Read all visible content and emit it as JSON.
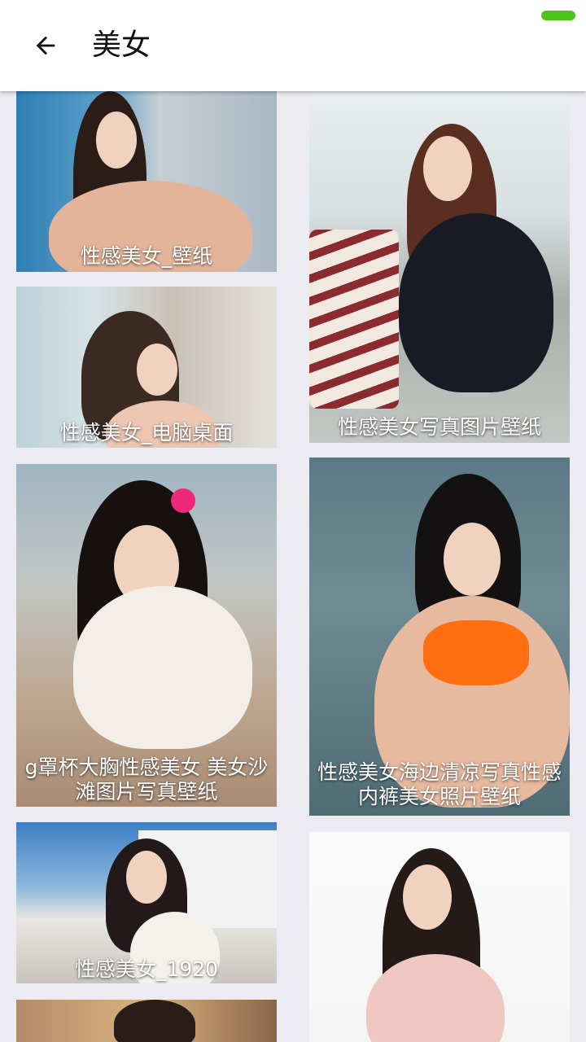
{
  "app_bar": {
    "title": "美女",
    "back_icon": "arrow-left-icon"
  },
  "colors": {
    "status_indicator": "#4BC41A",
    "background": "#ECEBF1"
  },
  "gallery": {
    "left_column": [
      {
        "caption": "性感美女_壁纸"
      },
      {
        "caption": "性感美女_电脑桌面"
      },
      {
        "caption": "g罩杯大胸性感美女 美女沙滩图片写真壁纸"
      },
      {
        "caption": "性感美女_1920"
      }
    ],
    "right_column": [
      {
        "caption": "性感美女写真图片壁纸"
      },
      {
        "caption": "性感美女海边清凉写真性感内裤美女照片壁纸"
      }
    ]
  }
}
